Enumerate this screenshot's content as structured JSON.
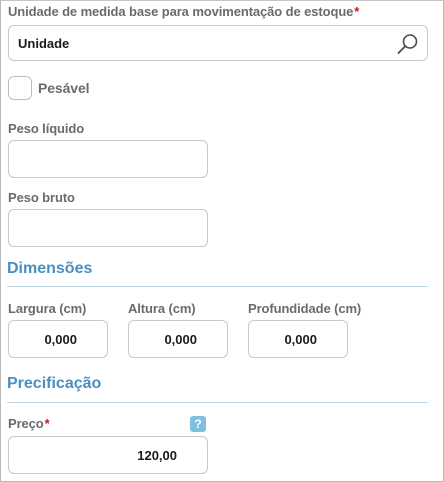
{
  "unit_field": {
    "label": "Unidade de medida base para movimentação de estoque",
    "required_mark": "*",
    "value": "Unidade",
    "search_icon": "search-icon"
  },
  "weighable": {
    "label": "Pesável",
    "checked": false
  },
  "net_weight": {
    "label": "Peso líquido",
    "value": ""
  },
  "gross_weight": {
    "label": "Peso bruto",
    "value": ""
  },
  "dimensions": {
    "title": "Dimensões",
    "width": {
      "label": "Largura (cm)",
      "value": "0,000"
    },
    "height": {
      "label": "Altura (cm)",
      "value": "0,000"
    },
    "depth": {
      "label": "Profundidade (cm)",
      "value": "0,000"
    }
  },
  "pricing": {
    "title": "Precificação",
    "price_label": "Preço",
    "required_mark": "*",
    "price_value": "120,00",
    "help_icon": "help-icon",
    "help_glyph": "?"
  },
  "colors": {
    "section_title": "#4a8fc0",
    "required": "#e01010",
    "help_badge": "#7fbfe0"
  }
}
